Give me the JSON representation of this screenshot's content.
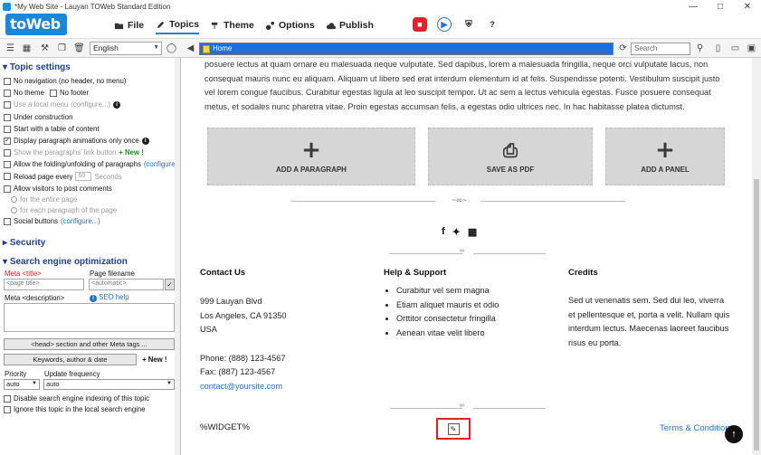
{
  "window": {
    "title": "*My Web Site - Lauyan TOWeb Standard Edition"
  },
  "logo": {
    "text": "toWeb"
  },
  "menu": [
    {
      "label": "File",
      "icon": "folder-icon"
    },
    {
      "label": "Topics",
      "icon": "pen-icon"
    },
    {
      "label": "Theme",
      "icon": "paint-icon"
    },
    {
      "label": "Options",
      "icon": "gears-icon"
    },
    {
      "label": "Publish",
      "icon": "cloud-upload-icon"
    }
  ],
  "toolbar": {
    "language": "English",
    "address": "Home",
    "search_placeholder": "Search"
  },
  "left": {
    "topic_settings": "Topic settings",
    "opts": [
      "No navigation (no header, no menu)",
      "No theme",
      "No footer",
      "Use a local menu",
      "(configure...)",
      "Under construction",
      "Start with a table of content",
      "Display paragraph animations only once",
      "Show the paragraphs' link button",
      "+ New !",
      "Allow the folding/unfolding of paragraphs",
      "(configure...)",
      "Reload page every",
      "60",
      "Seconds",
      "Allow visitors to post comments",
      "for the entire page",
      "for each paragraph of the page",
      "Social buttons",
      "(configure...)"
    ],
    "security": "Security",
    "seo": "Search engine optimization",
    "meta_title_label": "Meta <title>",
    "page_filename_label": "Page filename",
    "page_title_placeholder": "<page title>",
    "automatic_placeholder": "<automatic>",
    "meta_desc_label": "Meta <description>",
    "seo_help": "SEO help",
    "head_btn": "<head> section and other Meta tags ...",
    "keywords_btn": "Keywords, author & date",
    "new_badge": "+ New !",
    "priority_label": "Priority",
    "update_label": "Update frequency",
    "priority_value": "auto",
    "update_value": "auto",
    "disable_index": "Disable search engine indexing of this topic",
    "ignore_local": "Ignore this topic in the local search engine"
  },
  "content": {
    "paragraph": "posuere lectus at quam ornare eu malesuada neque vulputate. Sed dapibus, lorem a malesuada fringilla, neque orci vulputate lacus, non consequat mauris nunc eu aliquam. Aliquam ut libero sed erat interdum elementum id at felis. Suspendisse potenti. Vestibulum suscipit justo vel lorem congue faucibus. Curabitur egestas ligula at leo suscipit tempor. Ut ac sem a lectus vehicula egestas. Fusce posuere consequat metus, et sodales nunc pharetra vitae. Proin egestas accumsan felis, a egestas odio ultrices nec. In hac habitasse platea dictumst.",
    "add_paragraph": "ADD A PARAGRAPH",
    "save_pdf": "SAVE AS PDF",
    "add_panel": "ADD A PANEL",
    "contact": {
      "title": "Contact Us",
      "addr1": "999 Lauyan Blvd",
      "addr2": "Los Angeles, CA 91350",
      "addr3": "USA",
      "phone": "Phone: (888) 123-4567",
      "fax": "Fax: (887) 123-4567",
      "email": "contact@yoursite.com"
    },
    "help": {
      "title": "Help & Support",
      "items": [
        "Curabitur vel sem magna",
        "Etiam aliquet mauris et odio",
        "Orttitor consectetur fringilla",
        "Aenean vitae velit libero"
      ]
    },
    "credits": {
      "title": "Credits",
      "text": "Sed ut venenatis sem. Sed dui leo, viverra et pellentesque et, porta a velit. Nullam quis interdum lectus. Maecenas laoreet faucibus risus eu porta."
    },
    "widget": "%WIDGET%",
    "terms": "Terms & Conditions"
  }
}
